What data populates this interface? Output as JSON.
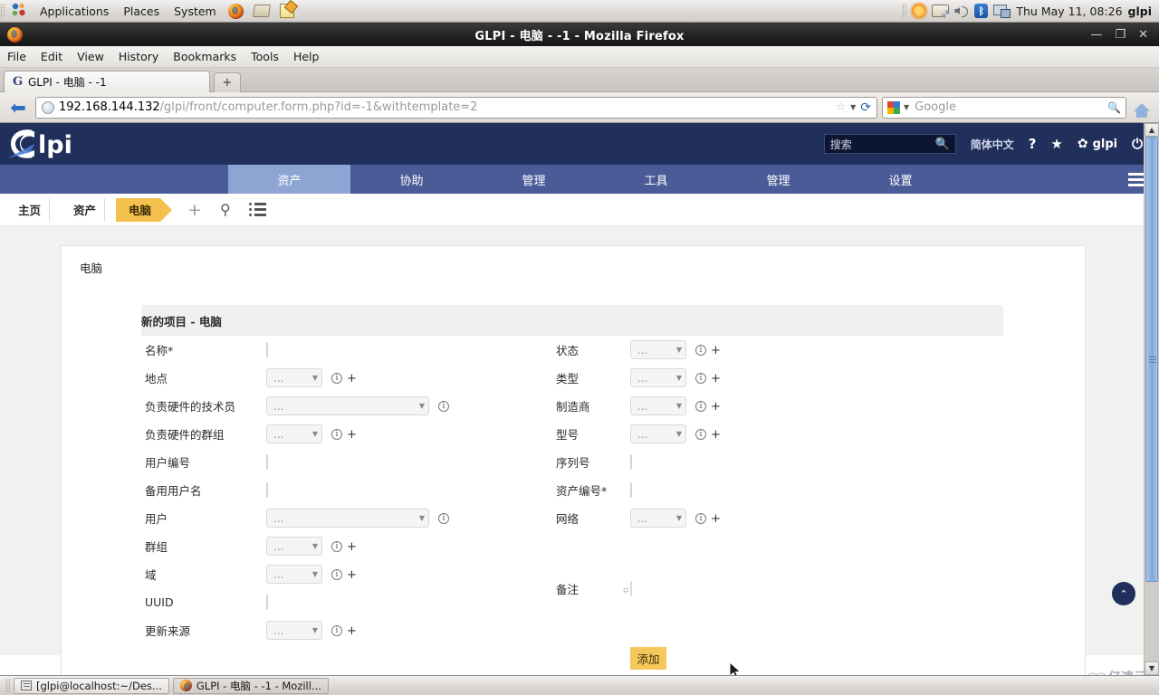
{
  "desktop": {
    "menu": [
      "Applications",
      "Places",
      "System"
    ],
    "tray_icons": [
      "firefox-icon",
      "dictionary-icon",
      "text-editor-icon"
    ],
    "status_icons": [
      "update-manager-icon",
      "printer-icon",
      "volume-icon",
      "bluetooth-icon",
      "network-icon"
    ],
    "clock": "Thu May 11, 08:26",
    "user": "glpi"
  },
  "browser": {
    "window_title": "GLPI - 电脑 - -1 - Mozilla Firefox",
    "window_controls": [
      "minimize",
      "maximize",
      "close"
    ],
    "menus": [
      "File",
      "Edit",
      "View",
      "History",
      "Bookmarks",
      "Tools",
      "Help"
    ],
    "tab_title": "GLPI - 电脑 - -1",
    "new_tab_label": "+",
    "url_host": "192.168.144.132",
    "url_path": "/glpi/front/computer.form.php?id=-1&withtemplate=2",
    "search_placeholder": "Google"
  },
  "glpi": {
    "brand": "glpi",
    "search_placeholder": "搜索",
    "language": "简体中文",
    "help_icon": "?",
    "favorites_icon": "star-icon",
    "settings_label": "glpi",
    "power_icon": "power-icon",
    "nav": [
      {
        "label": "资产",
        "active": true
      },
      {
        "label": "协助",
        "active": false
      },
      {
        "label": "管理",
        "active": false
      },
      {
        "label": "工具",
        "active": false
      },
      {
        "label": "管理",
        "active": false
      },
      {
        "label": "设置",
        "active": false
      }
    ],
    "breadcrumb": [
      {
        "label": "主页",
        "active": false
      },
      {
        "label": "资产",
        "active": false
      },
      {
        "label": "电脑",
        "active": true
      }
    ],
    "breadcrumb_tools": [
      "plus-icon",
      "search-icon",
      "list-icon"
    ],
    "panel_title": "电脑",
    "form_title": "新的项目 - 电脑",
    "dropdown_value": "...",
    "fields_left": [
      {
        "label": "名称*",
        "type": "text",
        "value": ""
      },
      {
        "label": "地点",
        "type": "dropdown-small",
        "value": "..."
      },
      {
        "label": "负责硬件的技术员",
        "type": "dropdown-large",
        "value": "..."
      },
      {
        "label": "负责硬件的群组",
        "type": "dropdown-small",
        "value": "..."
      },
      {
        "label": "用户编号",
        "type": "text",
        "value": ""
      },
      {
        "label": "备用用户名",
        "type": "text",
        "value": ""
      },
      {
        "label": "用户",
        "type": "dropdown-large",
        "value": "..."
      },
      {
        "label": "群组",
        "type": "dropdown-small",
        "value": "..."
      },
      {
        "label": "域",
        "type": "dropdown-small",
        "value": "..."
      },
      {
        "label": "UUID",
        "type": "text",
        "value": ""
      },
      {
        "label": "更新来源",
        "type": "dropdown-small",
        "value": "..."
      }
    ],
    "fields_right": [
      {
        "label": "状态",
        "type": "dropdown-small",
        "value": "..."
      },
      {
        "label": "类型",
        "type": "dropdown-small",
        "value": "..."
      },
      {
        "label": "制造商",
        "type": "dropdown-small",
        "value": "..."
      },
      {
        "label": "型号",
        "type": "dropdown-small",
        "value": "..."
      },
      {
        "label": "序列号",
        "type": "text",
        "value": ""
      },
      {
        "label": "资产编号*",
        "type": "text",
        "value": ""
      },
      {
        "label": "网络",
        "type": "dropdown-small",
        "value": "..."
      },
      {
        "label": "备注",
        "type": "textarea",
        "value": ""
      }
    ],
    "submit_label": "添加",
    "back_to_top": "⌃"
  },
  "watermark": "亿速云",
  "taskbar": [
    {
      "label": "[glpi@localhost:~/Des...",
      "icon": "terminal-icon",
      "active": false
    },
    {
      "label": "GLPI - 电脑 - -1 - Mozill...",
      "icon": "firefox-icon",
      "active": true
    }
  ],
  "colors": {
    "glpi_header": "#21305b",
    "glpi_nav": "#4a5b97",
    "glpi_nav_active": "#8ea4d2",
    "breadcrumb_active": "#f5c14e",
    "submit_button": "#f6c85c"
  }
}
